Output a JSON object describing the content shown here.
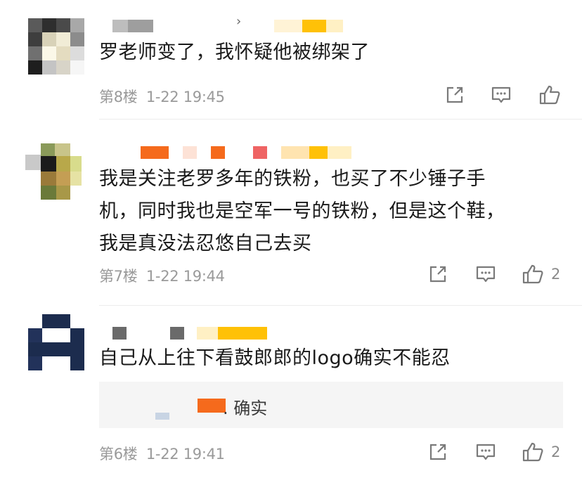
{
  "comments": [
    {
      "text_lines": [
        "罗老师变了，我怀疑他被绑架了"
      ],
      "floor": "第8楼",
      "time": "1-22 19:45",
      "likes": ""
    },
    {
      "text_lines": [
        "我是关注老罗多年的铁粉，也买了不少锤子手",
        "机，同时我也是空军一号的铁粉，但是这个鞋，",
        "我是真没法忍悠自己去买"
      ],
      "floor": "第7楼",
      "time": "1-22 19:44",
      "likes": "2"
    },
    {
      "text_lines": [
        "自己从上往下看鼓郎郎的logo确实不能忍"
      ],
      "floor": "第6楼",
      "time": "1-22 19:41",
      "likes": "2",
      "reply": {
        "text": ". 确实"
      }
    }
  ],
  "icons": {
    "repost": "share-icon",
    "comment": "comment-icon",
    "like": "thumbs-up-icon"
  },
  "colors": {
    "meta_gray": "#9a9a9a",
    "icon_gray": "#7a7a7a",
    "reply_bg": "#f5f5f5",
    "name_orange": "#f56a1c",
    "name_yellow": "#ffc107"
  }
}
